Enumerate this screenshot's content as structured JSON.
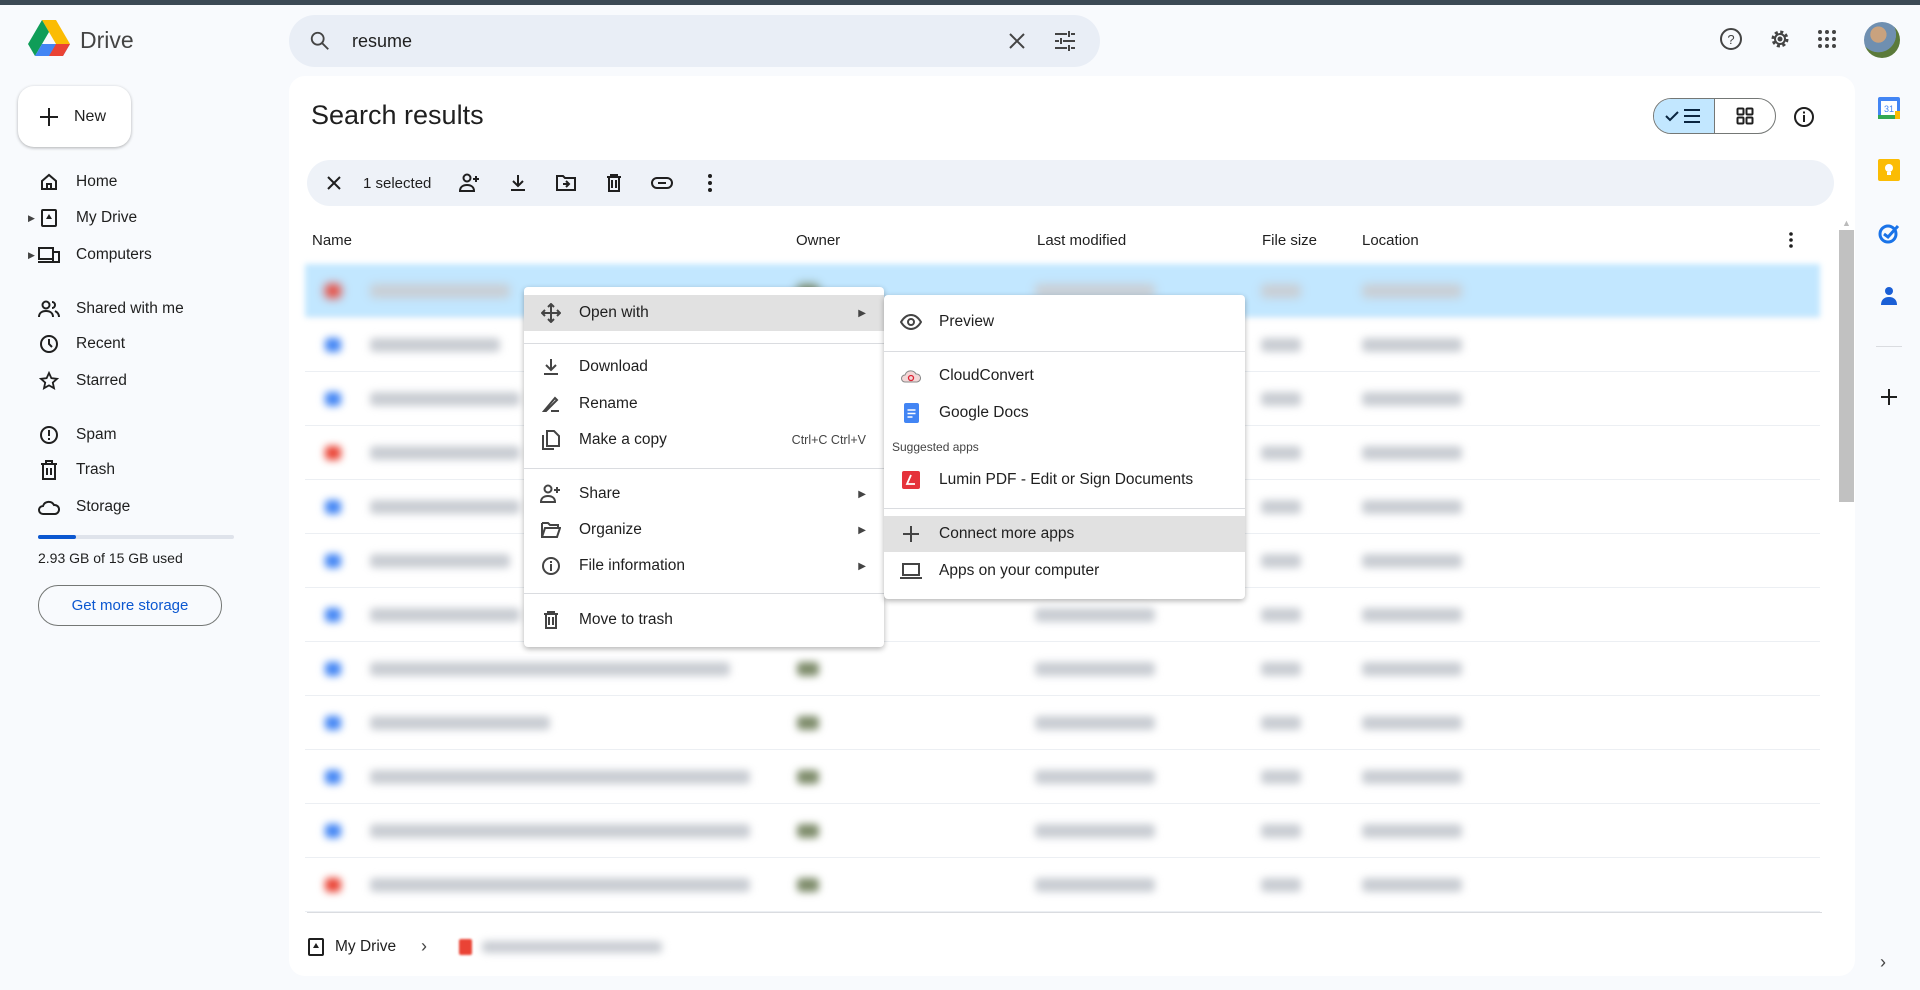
{
  "app": {
    "name": "Drive"
  },
  "search": {
    "query": "resume"
  },
  "sidebar": {
    "new_label": "New",
    "items": [
      {
        "label": "Home",
        "icon": "home-icon"
      },
      {
        "label": "My Drive",
        "icon": "my-drive-icon",
        "expandable": true
      },
      {
        "label": "Computers",
        "icon": "computers-icon",
        "expandable": true
      },
      {
        "label": "Shared with me",
        "icon": "shared-icon"
      },
      {
        "label": "Recent",
        "icon": "clock-icon"
      },
      {
        "label": "Starred",
        "icon": "star-icon"
      },
      {
        "label": "Spam",
        "icon": "spam-icon"
      },
      {
        "label": "Trash",
        "icon": "trash-icon"
      },
      {
        "label": "Storage",
        "icon": "cloud-icon"
      }
    ],
    "storage": {
      "text": "2.93 GB of 15 GB used",
      "used_fraction": 0.195,
      "button": "Get more storage"
    }
  },
  "main": {
    "title": "Search results",
    "view": "list",
    "selection": {
      "text": "1 selected"
    },
    "columns": [
      "Name",
      "Owner",
      "Last modified",
      "File size",
      "Location"
    ],
    "row_count": 12,
    "selected_row": 0
  },
  "context_menu": {
    "items": [
      {
        "label": "Open with",
        "submenu": true,
        "highlighted": true
      },
      {
        "label": "Download"
      },
      {
        "label": "Rename"
      },
      {
        "label": "Make a copy",
        "shortcut": "Ctrl+C Ctrl+V"
      },
      {
        "label": "Share",
        "submenu": true
      },
      {
        "label": "Organize",
        "submenu": true
      },
      {
        "label": "File information",
        "submenu": true
      },
      {
        "label": "Move to trash"
      }
    ]
  },
  "open_with": {
    "preview": "Preview",
    "apps": [
      "CloudConvert",
      "Google Docs"
    ],
    "suggested_heading": "Suggested apps",
    "suggested": [
      "Lumin PDF - Edit or Sign Documents"
    ],
    "connect": "Connect more apps",
    "computer": "Apps on your computer"
  },
  "breadcrumb": {
    "root": "My Drive"
  },
  "colors": {
    "accent": "#0b57d0",
    "selected_row": "#c2e7ff",
    "toggle_active": "#c2e7ff"
  }
}
